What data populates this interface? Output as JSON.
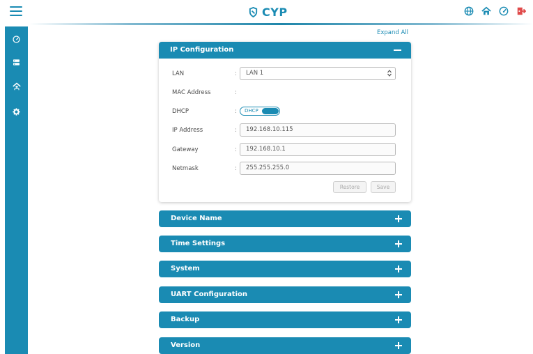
{
  "header": {
    "logo_text": "CYP",
    "brand_color": "#1a8bb3",
    "icons": [
      "globe-icon",
      "home-icon",
      "dashboard-icon",
      "logout-icon"
    ]
  },
  "sidebar": {
    "items": [
      {
        "icon": "dashboard-icon"
      },
      {
        "icon": "server-icon"
      },
      {
        "icon": "network-home-icon"
      },
      {
        "icon": "gear-icon"
      }
    ]
  },
  "expand_all": "Expand All",
  "ip_config": {
    "title": "IP Configuration",
    "lan_label": "LAN",
    "lan_value": "LAN 1",
    "mac_label": "MAC Address",
    "mac_value": "",
    "dhcp_label": "DHCP",
    "dhcp_toggle_text": "DHCP",
    "dhcp_on": true,
    "ip_label": "IP Address",
    "ip_value": "192.168.10.115",
    "gateway_label": "Gateway",
    "gateway_value": "192.168.10.1",
    "netmask_label": "Netmask",
    "netmask_value": "255.255.255.0",
    "colon": ":",
    "restore_label": "Restore",
    "save_label": "Save"
  },
  "panels": [
    {
      "title": "Device Name"
    },
    {
      "title": "Time Settings"
    },
    {
      "title": "System"
    },
    {
      "title": "UART Configuration"
    },
    {
      "title": "Backup"
    },
    {
      "title": "Version"
    }
  ]
}
